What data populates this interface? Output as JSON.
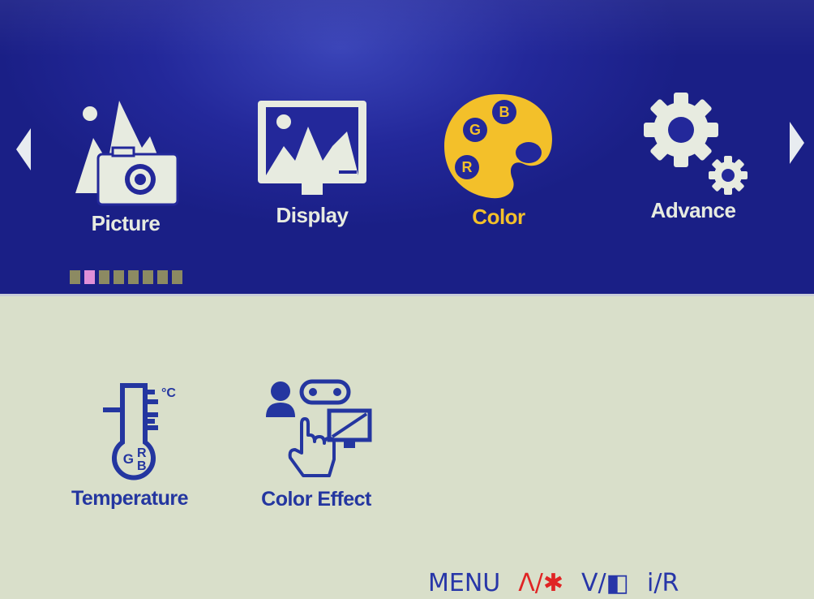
{
  "nav": {
    "left_arrow": "arrow-left",
    "right_arrow": "arrow-right"
  },
  "tabs": [
    {
      "label": "Picture",
      "icon": "picture-icon",
      "active": false
    },
    {
      "label": "Display",
      "icon": "display-icon",
      "active": false
    },
    {
      "label": "Color",
      "icon": "palette-icon",
      "active": true
    },
    {
      "label": "Advance",
      "icon": "gear-icon",
      "active": false
    }
  ],
  "pager": {
    "count": 8,
    "active_index": 1
  },
  "palette_letters": {
    "b": "B",
    "g": "G",
    "r": "R"
  },
  "menu_items": [
    {
      "label": "Temperature",
      "icon": "thermometer-icon",
      "unit": "°C",
      "letters": {
        "g": "G",
        "r": "R",
        "b": "B"
      }
    },
    {
      "label": "Color Effect",
      "icon": "color-effect-icon"
    }
  ],
  "hints": {
    "menu": "MENU",
    "up": "Λ/",
    "up_symbol": "✱",
    "down": "V/",
    "down_symbol": "◧",
    "info": "i/R"
  },
  "colors": {
    "band": "#23289a",
    "panel": "#d9dfca",
    "active": "#f3c02a",
    "text_blue": "#2436a0",
    "hint_red": "#e02424"
  }
}
